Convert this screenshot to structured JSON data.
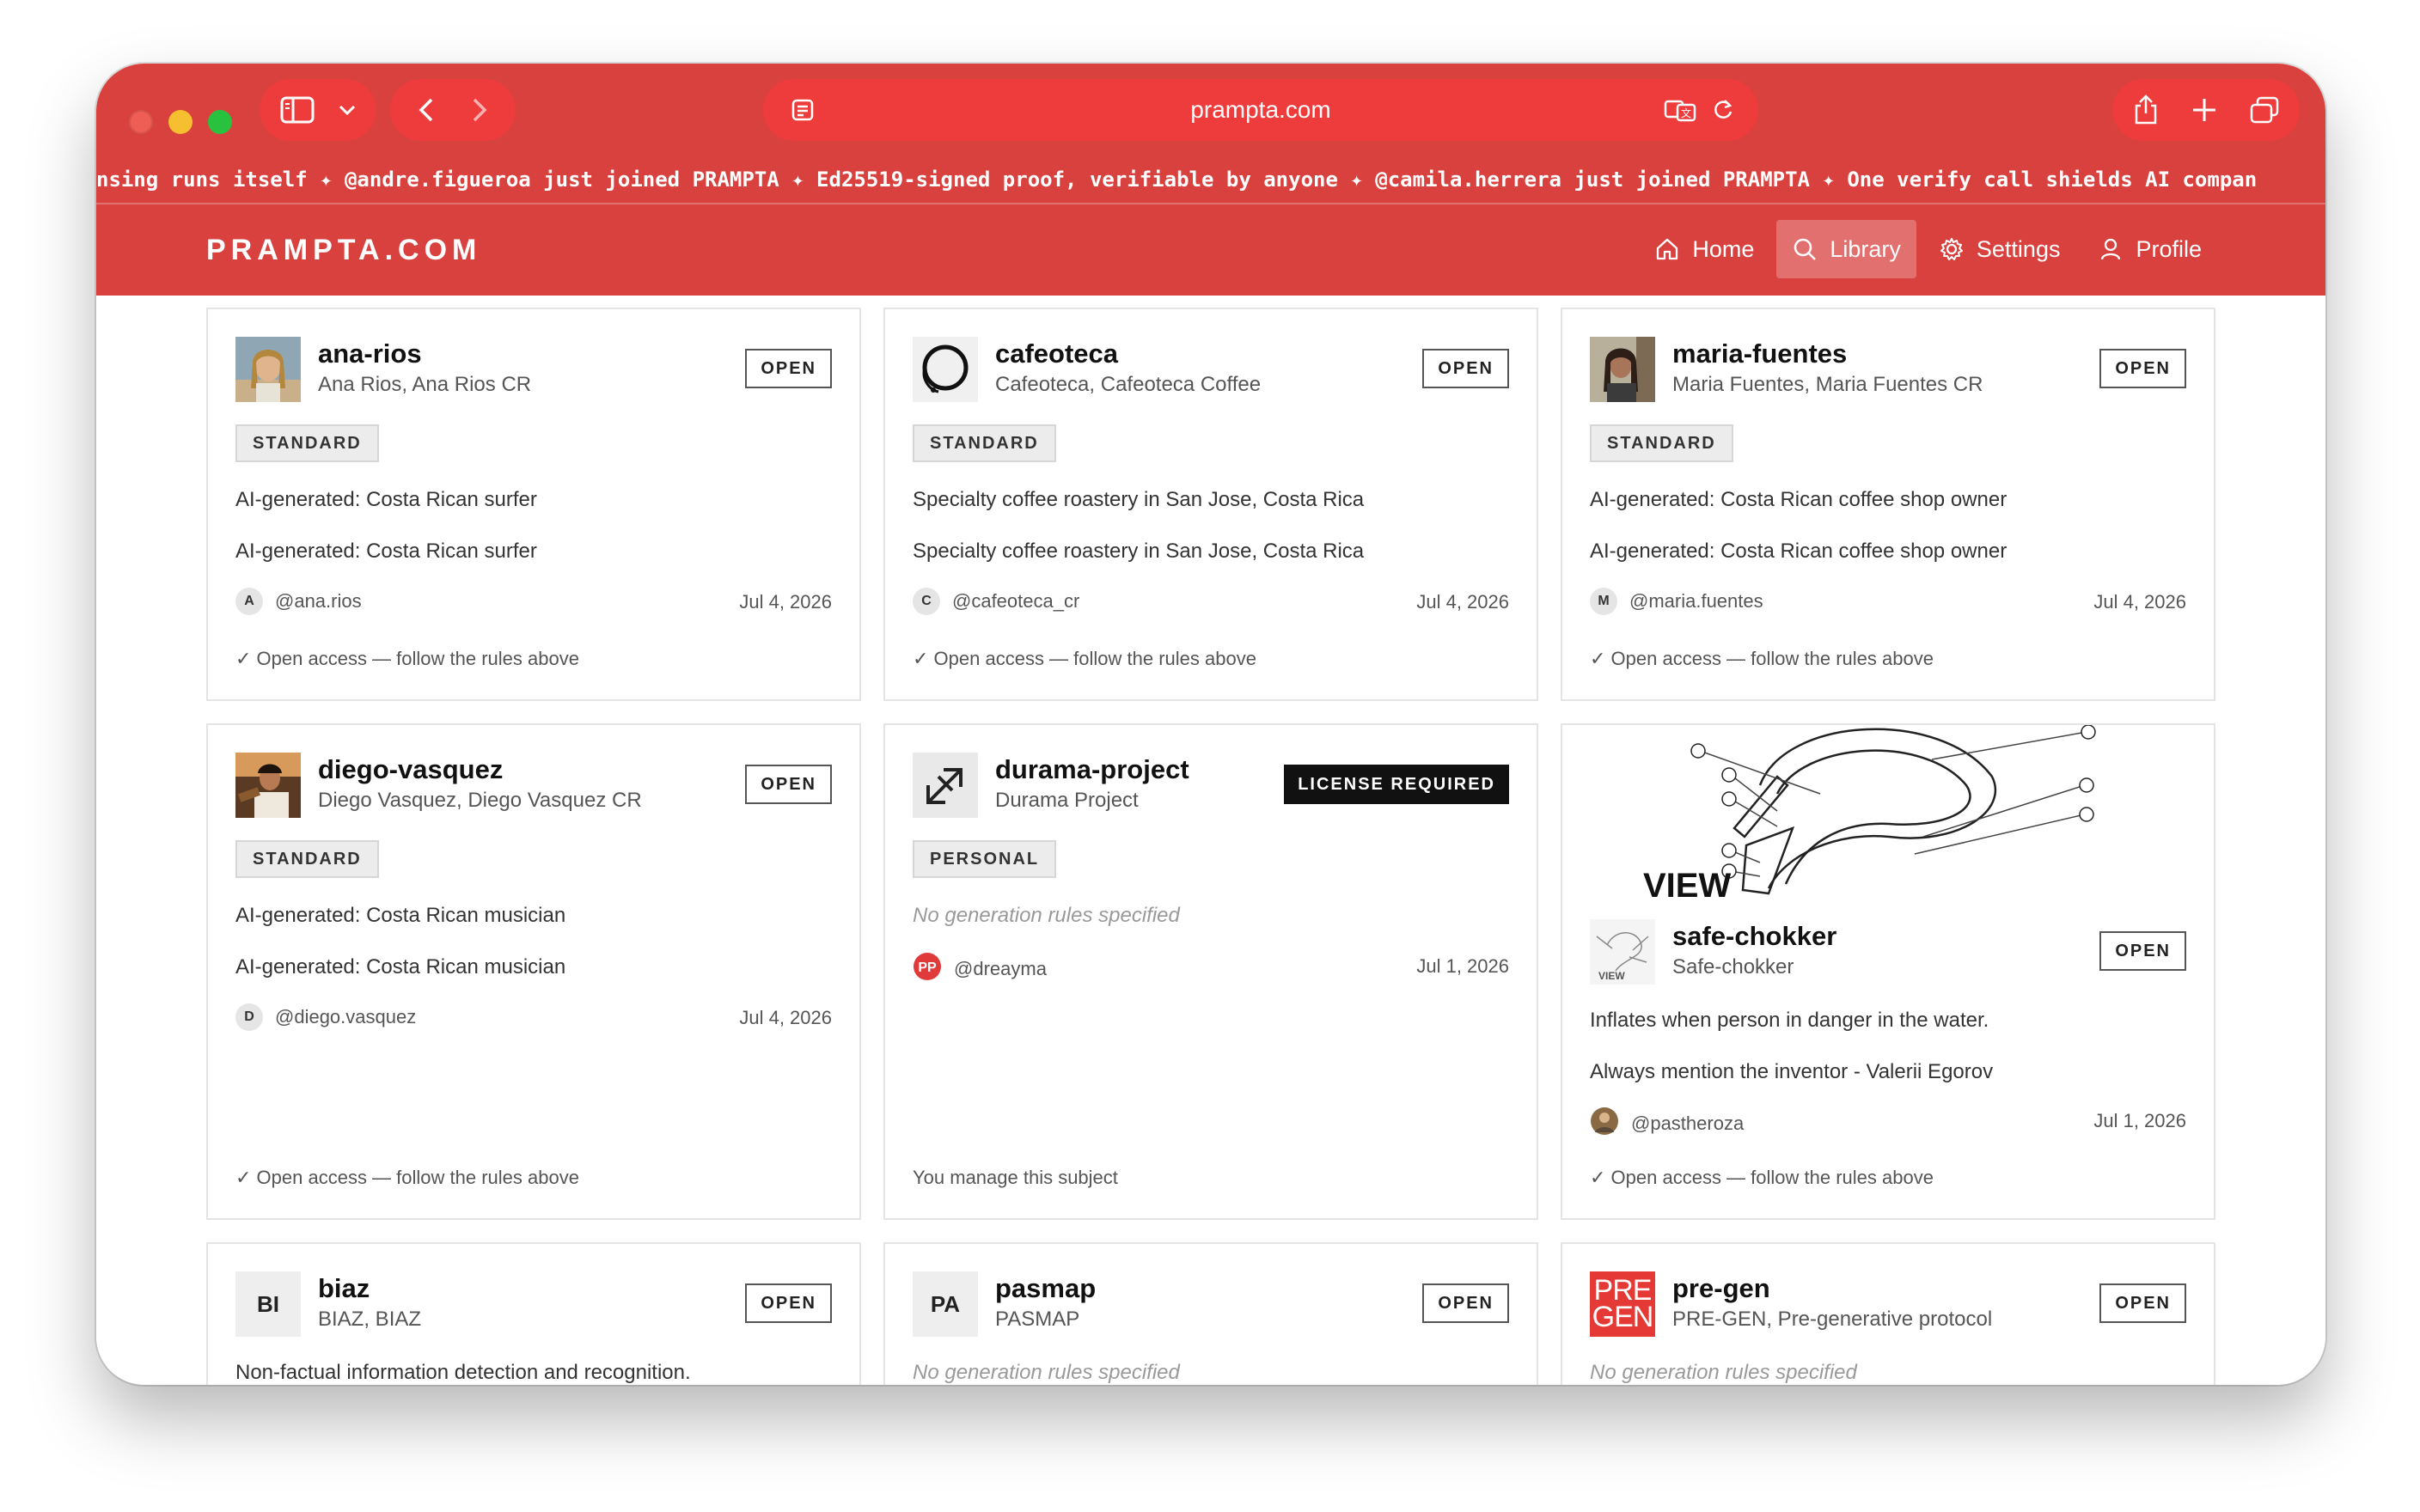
{
  "browser": {
    "url": "prampta.com",
    "ticker": "nsing runs itself ✦ @andre.figueroa just joined PRAMPTA ✦ Ed25519-signed proof, verifiable by anyone ✦ @camila.herrera just joined PRAMPTA ✦ One verify call shields AI compan"
  },
  "nav": {
    "brand": "PRAMPTA.COM",
    "links": [
      {
        "label": "Home",
        "icon": "home-icon"
      },
      {
        "label": "Library",
        "icon": "search-icon",
        "active": true
      },
      {
        "label": "Settings",
        "icon": "gear-icon"
      },
      {
        "label": "Profile",
        "icon": "user-icon"
      }
    ]
  },
  "cards": [
    {
      "name": "ana-rios",
      "aliases": "Ana Rios, Ana Rios CR",
      "badge": "OPEN",
      "tier": "STANDARD",
      "rule1": "AI-generated: Costa Rican surfer",
      "rule2": "AI-generated: Costa Rican surfer",
      "owner_initial": "A",
      "owner": "@ana.rios",
      "date": "Jul 4, 2026",
      "footer": "✓ Open access — follow the rules above"
    },
    {
      "name": "cafeoteca",
      "aliases": "Cafeoteca, Cafeoteca Coffee",
      "badge": "OPEN",
      "tier": "STANDARD",
      "rule1": "Specialty coffee roastery in San Jose, Costa Rica",
      "rule2": "Specialty coffee roastery in San Jose, Costa Rica",
      "owner_initial": "C",
      "owner": "@cafeoteca_cr",
      "date": "Jul 4, 2026",
      "footer": "✓ Open access — follow the rules above"
    },
    {
      "name": "maria-fuentes",
      "aliases": "Maria Fuentes, Maria Fuentes CR",
      "badge": "OPEN",
      "tier": "STANDARD",
      "rule1": "AI-generated: Costa Rican coffee shop owner",
      "rule2": "AI-generated: Costa Rican coffee shop owner",
      "owner_initial": "M",
      "owner": "@maria.fuentes",
      "date": "Jul 4, 2026",
      "footer": "✓ Open access — follow the rules above"
    },
    {
      "name": "diego-vasquez",
      "aliases": "Diego Vasquez, Diego Vasquez CR",
      "badge": "OPEN",
      "tier": "STANDARD",
      "rule1": "AI-generated: Costa Rican musician",
      "rule2": "AI-generated: Costa Rican musician",
      "owner_initial": "D",
      "owner": "@diego.vasquez",
      "date": "Jul 4, 2026",
      "footer": "✓ Open access — follow the rules above"
    },
    {
      "name": "durama-project",
      "aliases": "Durama Project",
      "badge": "LICENSE REQUIRED",
      "tier": "PERSONAL",
      "rule1": "No generation rules specified",
      "owner": "@dreayma",
      "date": "Jul 1, 2026",
      "footer": "You manage this subject"
    },
    {
      "name": "safe-chokker",
      "aliases": "Safe-chokker",
      "badge": "OPEN",
      "image_label": "VIEW",
      "rule1": "Inflates when person in danger in the water.",
      "rule2": "Always mention the inventor - Valerii Egorov",
      "owner": "@pastheroza",
      "date": "Jul 1, 2026",
      "footer": "✓ Open access — follow the rules above"
    },
    {
      "name": "biaz",
      "aliases": "BIAZ, BIAZ",
      "badge": "OPEN",
      "initials": "BI",
      "rule1": "Non-factual information detection and recognition."
    },
    {
      "name": "pasmap",
      "aliases": "PASMAP",
      "badge": "OPEN",
      "initials": "PA",
      "rule1": "No generation rules specified"
    },
    {
      "name": "pre-gen",
      "aliases": "PRE-GEN, Pre-generative protocol",
      "badge": "OPEN",
      "logo_line1": "PRE",
      "logo_line2": "GEN",
      "rule1": "No generation rules specified"
    }
  ]
}
